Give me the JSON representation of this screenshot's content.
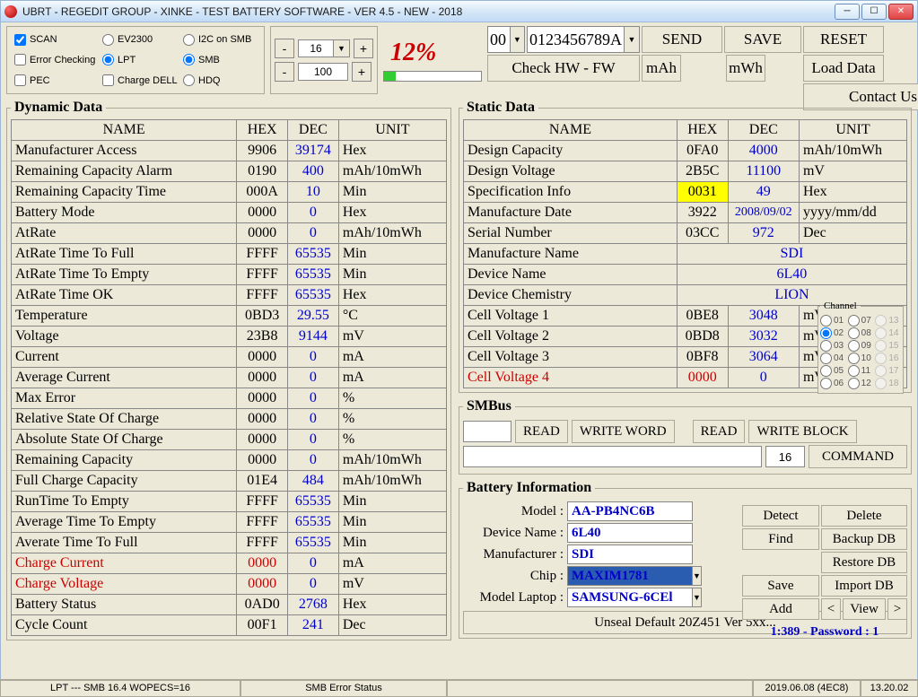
{
  "title": "UBRT - REGEDIT GROUP - XINKE - TEST BATTERY SOFTWARE - VER 4.5 - NEW - 2018",
  "opts": {
    "scan": "SCAN",
    "ev2300": "EV2300",
    "i2c": "I2C on SMB",
    "errchk": "Error Checking",
    "lpt": "LPT",
    "smb": "SMB",
    "pec": "PEC",
    "chargedell": "Charge DELL",
    "hdq": "HDQ"
  },
  "spin1": "16",
  "spin2": "100",
  "percent": "12%",
  "addr1": "00",
  "addr2": "0123456789A",
  "btns": {
    "send": "SEND",
    "save": "SAVE",
    "reset": "RESET",
    "checkhw": "Check HW - FW",
    "mah": "mAh",
    "mwh": "mWh",
    "loaddata": "Load Data",
    "contactus": "Contact Us"
  },
  "dyn_legend": "Dynamic Data",
  "static_legend": "Static Data",
  "smbus_legend": "SMBus",
  "binfo_legend": "Battery Information",
  "hdr": {
    "name": "NAME",
    "hex": "HEX",
    "dec": "DEC",
    "unit": "UNIT"
  },
  "dyn": [
    {
      "n": "Manufacturer Access",
      "h": "9906",
      "d": "39174",
      "u": "Hex"
    },
    {
      "n": "Remaining Capacity Alarm",
      "h": "0190",
      "d": "400",
      "u": "mAh/10mWh"
    },
    {
      "n": "Remaining Capacity Time",
      "h": "000A",
      "d": "10",
      "u": "Min"
    },
    {
      "n": "Battery Mode",
      "h": "0000",
      "d": "0",
      "u": "Hex"
    },
    {
      "n": "AtRate",
      "h": "0000",
      "d": "0",
      "u": "mAh/10mWh"
    },
    {
      "n": "AtRate Time To Full",
      "h": "FFFF",
      "d": "65535",
      "u": "Min"
    },
    {
      "n": "AtRate Time To Empty",
      "h": "FFFF",
      "d": "65535",
      "u": "Min"
    },
    {
      "n": "AtRate Time OK",
      "h": "FFFF",
      "d": "65535",
      "u": "Hex"
    },
    {
      "n": "Temperature",
      "h": "0BD3",
      "d": "29.55",
      "u": "°C"
    },
    {
      "n": "Voltage",
      "h": "23B8",
      "d": "9144",
      "u": "mV"
    },
    {
      "n": "Current",
      "h": "0000",
      "d": "0",
      "u": "mA"
    },
    {
      "n": "Average Current",
      "h": "0000",
      "d": "0",
      "u": "mA"
    },
    {
      "n": "Max Error",
      "h": "0000",
      "d": "0",
      "u": "%"
    },
    {
      "n": "Relative State Of Charge",
      "h": "0000",
      "d": "0",
      "u": "%"
    },
    {
      "n": "Absolute State Of Charge",
      "h": "0000",
      "d": "0",
      "u": "%"
    },
    {
      "n": "Remaining Capacity",
      "h": "0000",
      "d": "0",
      "u": "mAh/10mWh"
    },
    {
      "n": "Full Charge Capacity",
      "h": "01E4",
      "d": "484",
      "u": "mAh/10mWh"
    },
    {
      "n": "RunTime To Empty",
      "h": "FFFF",
      "d": "65535",
      "u": "Min"
    },
    {
      "n": "Average Time To Empty",
      "h": "FFFF",
      "d": "65535",
      "u": "Min"
    },
    {
      "n": "Averate Time To Full",
      "h": "FFFF",
      "d": "65535",
      "u": "Min"
    },
    {
      "n": "Charge Current",
      "h": "0000",
      "d": "0",
      "u": "mA",
      "red": true
    },
    {
      "n": "Charge Voltage",
      "h": "0000",
      "d": "0",
      "u": "mV",
      "red": true
    },
    {
      "n": "Battery Status",
      "h": "0AD0",
      "d": "2768",
      "u": "Hex"
    },
    {
      "n": "Cycle Count",
      "h": "00F1",
      "d": "241",
      "u": "Dec"
    }
  ],
  "stat": [
    {
      "n": "Design Capacity",
      "h": "0FA0",
      "d": "4000",
      "u": "mAh/10mWh"
    },
    {
      "n": "Design Voltage",
      "h": "2B5C",
      "d": "11100",
      "u": "mV"
    },
    {
      "n": "Specification Info",
      "h": "0031",
      "d": "49",
      "u": "Hex",
      "hl": true
    },
    {
      "n": "Manufacture Date",
      "h": "3922",
      "d": "2008/09/02",
      "u": "yyyy/mm/dd"
    },
    {
      "n": "Serial Number",
      "h": "03CC",
      "d": "972",
      "u": "Dec"
    },
    {
      "n": "Manufacture Name",
      "wide": "SDI"
    },
    {
      "n": "Device Name",
      "wide": "6L40"
    },
    {
      "n": "Device Chemistry",
      "wide": "LION"
    },
    {
      "n": "Cell Voltage 1",
      "h": "0BE8",
      "d": "3048",
      "u": "mV"
    },
    {
      "n": "Cell Voltage 2",
      "h": "0BD8",
      "d": "3032",
      "u": "mV"
    },
    {
      "n": "Cell Voltage 3",
      "h": "0BF8",
      "d": "3064",
      "u": "mV"
    },
    {
      "n": "Cell Voltage 4",
      "h": "0000",
      "d": "0",
      "u": "mV",
      "red": true
    }
  ],
  "channels": [
    "01",
    "07",
    "13",
    "02",
    "08",
    "14",
    "03",
    "09",
    "15",
    "04",
    "10",
    "16",
    "05",
    "11",
    "17",
    "06",
    "12",
    "18"
  ],
  "ch_sel": "02",
  "smbus": {
    "read1": "READ",
    "writeword": "WRITE WORD",
    "read2": "READ",
    "writeblock": "WRITE BLOCK",
    "val": "16",
    "cmd": "COMMAND"
  },
  "binfo": {
    "model_l": "Model :",
    "model": "AA-PB4NC6B",
    "devname_l": "Device Name :",
    "devname": "6L40",
    "mfr_l": "Manufacturer :",
    "mfr": "SDI",
    "chip_l": "Chip :",
    "chip": "MAXIM1781",
    "laptop_l": "Model Laptop :",
    "laptop": "SAMSUNG-6CEl",
    "detect": "Detect",
    "delete": "Delete",
    "find": "Find",
    "backup": "Backup DB",
    "restore": "Restore DB",
    "save": "Save",
    "import": "Import DB",
    "add": "Add",
    "view": "View",
    "prev": "<",
    "next": ">",
    "unseal": "Unseal Default 20Z451 Ver 5xx...",
    "pw": "1:389 - Password : 1"
  },
  "status": {
    "s1": "LPT --- SMB 16.4 WOPECS=16",
    "s2": "SMB Error Status",
    "s3": "2019.06.08 (4EC8)",
    "s4": "13.20.02"
  }
}
